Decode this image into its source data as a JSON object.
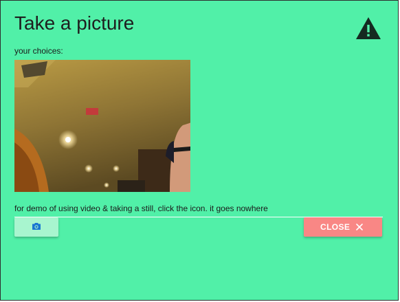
{
  "dialog": {
    "title": "Take a picture",
    "choices_label": "your choices:",
    "demo_text": "for demo of using video & taking a still, click the icon. it goes nowhere",
    "close_label": "CLOSE"
  },
  "icons": {
    "warning": "warning-icon",
    "camera": "camera-icon",
    "close": "close-icon"
  },
  "colors": {
    "background": "#51f0a8",
    "camera_button": "#a8f5cf",
    "camera_icon": "#1976d2",
    "close_button": "#f98785",
    "title_text": "#1e1e1e"
  }
}
